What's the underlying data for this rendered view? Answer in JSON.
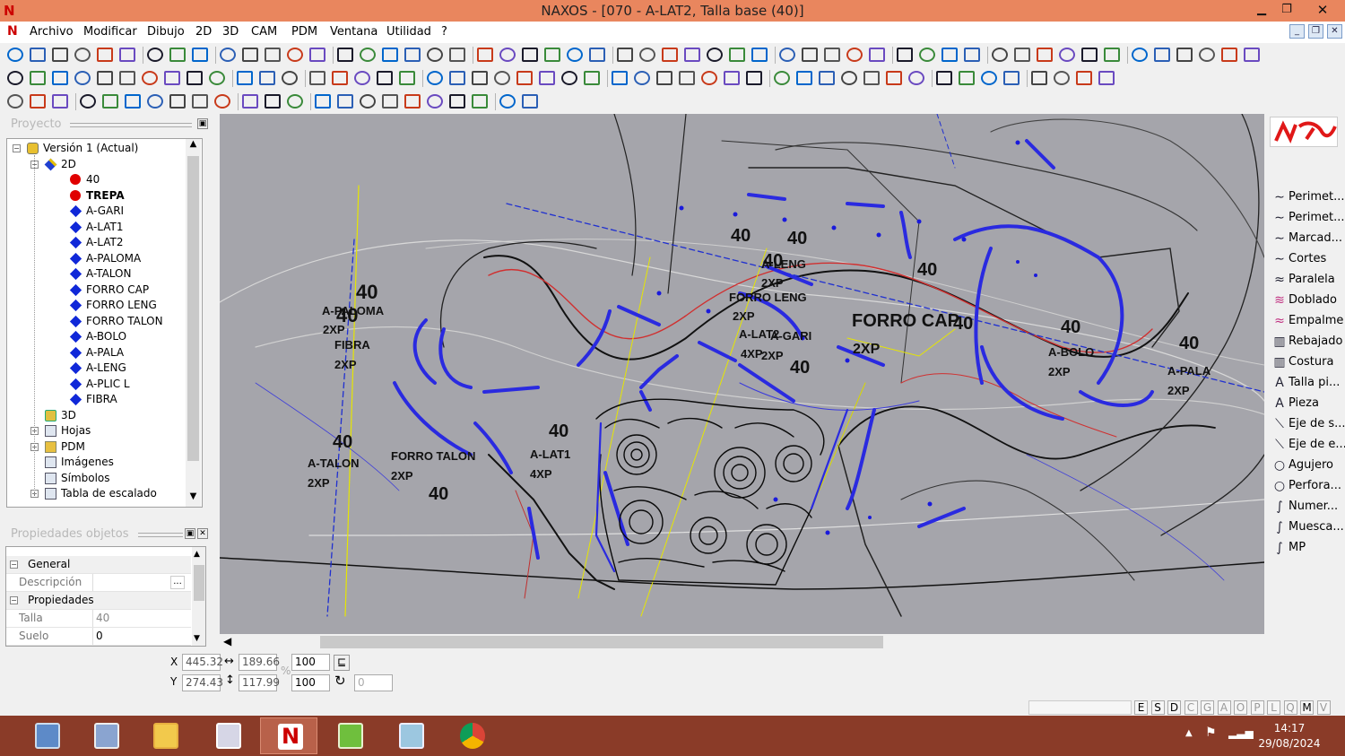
{
  "window": {
    "title": "NAXOS - [070 - A-LAT2, Talla base (40)]",
    "logo": "N",
    "colors": {
      "titlebar": "#e9865e",
      "canvas": "#a5a5ab",
      "taskbar": "#8a3b28"
    }
  },
  "window_controls": {
    "minimize": "▁",
    "restore": "❐",
    "close": "✕"
  },
  "menu": [
    "Archivo",
    "Modificar",
    "Dibujo",
    "2D",
    "3D",
    "CAM",
    "PDM",
    "Ventana",
    "Utilidad",
    "?"
  ],
  "mdi_controls": {
    "minimize": "_",
    "restore": "❐",
    "close": "✕"
  },
  "project_panel": {
    "title": "Proyecto",
    "pin": "▣"
  },
  "tree": {
    "items": [
      "Versión 1 (Actual)",
      "2D",
      "40",
      "TREPA",
      "A-GARI",
      "A-LAT1",
      "A-LAT2",
      "A-PALOMA",
      "A-TALON",
      "FORRO CAP",
      "FORRO LENG",
      "FORRO TALON",
      "A-BOLO",
      "A-PALA",
      "A-LENG",
      "A-PLIC L",
      "FIBRA",
      "3D",
      "Hojas",
      "PDM",
      "Imágenes",
      "Símbolos",
      "Tabla de escalado"
    ]
  },
  "properties_panel": {
    "title": "Propiedades objetos",
    "pin": "▣",
    "close": "✕",
    "categories": [
      "General",
      "Propiedades"
    ],
    "rows": [
      {
        "label": "Descripción",
        "value": "",
        "button": "..."
      },
      {
        "label": "Talla",
        "value": "40"
      },
      {
        "label": "Suelo",
        "value": "0"
      }
    ]
  },
  "canvas_labels": [
    {
      "text": "40"
    },
    {
      "text": "A-PALOMA"
    },
    {
      "text": "2XP"
    },
    {
      "text": "40"
    },
    {
      "text": "FIBRA"
    },
    {
      "text": "2XP"
    },
    {
      "text": "40"
    },
    {
      "text": "A-TALON"
    },
    {
      "text": "2XP"
    },
    {
      "text": "FORRO TALON"
    },
    {
      "text": "2XP"
    },
    {
      "text": "40"
    },
    {
      "text": "40"
    },
    {
      "text": "A-LAT1"
    },
    {
      "text": "4XP"
    },
    {
      "text": "40"
    },
    {
      "text": "40"
    },
    {
      "text": "40"
    },
    {
      "text": "A-LENG"
    },
    {
      "text": "2XP"
    },
    {
      "text": "FORRO LENG"
    },
    {
      "text": "2XP"
    },
    {
      "text": "A-LAT2"
    },
    {
      "text": "A-GARI"
    },
    {
      "text": "4XP"
    },
    {
      "text": "2XP"
    },
    {
      "text": "40"
    },
    {
      "text": "FORRO CAP"
    },
    {
      "text": "2XP"
    },
    {
      "text": "40"
    },
    {
      "text": "40"
    },
    {
      "text": "40"
    },
    {
      "text": "A-BOLO"
    },
    {
      "text": "2XP"
    },
    {
      "text": "40"
    },
    {
      "text": "A-PALA"
    },
    {
      "text": "2XP"
    }
  ],
  "right_panel": {
    "items": [
      {
        "label": "Perimet...",
        "icon": "curve-icon"
      },
      {
        "label": "Perimet...",
        "icon": "curve-icon"
      },
      {
        "label": "Marcad...",
        "icon": "curve-icon"
      },
      {
        "label": "Cortes",
        "icon": "curve-icon"
      },
      {
        "label": "Paralela",
        "icon": "parallel-icon"
      },
      {
        "label": "Doblado",
        "icon": "fold-icon"
      },
      {
        "label": "Empalme",
        "icon": "join-icon"
      },
      {
        "label": "Rebajado",
        "icon": "skive-icon"
      },
      {
        "label": "Costura",
        "icon": "seam-icon"
      },
      {
        "label": "Talla pi...",
        "icon": "text-a-icon"
      },
      {
        "label": "Pieza",
        "icon": "text-a-icon"
      },
      {
        "label": "Eje de s...",
        "icon": "axis-icon"
      },
      {
        "label": "Eje de e...",
        "icon": "axis-icon"
      },
      {
        "label": "Agujero",
        "icon": "circle-icon"
      },
      {
        "label": "Perfora...",
        "icon": "circle-icon"
      },
      {
        "label": "Numer...",
        "icon": "pen-icon"
      },
      {
        "label": "Muesca...",
        "icon": "pen-icon"
      },
      {
        "label": "MP",
        "icon": "pen-icon"
      }
    ]
  },
  "coords": {
    "x_label": "X",
    "y_label": "Y",
    "x": "445.32",
    "y": "274.43",
    "width": "189.66",
    "height": "117.99",
    "scale_x": "100",
    "scale_y": "100",
    "rotation": "0",
    "percent": "%"
  },
  "status_letters": [
    "E",
    "S",
    "D",
    "C",
    "G",
    "A",
    "O",
    "P",
    "L",
    "Q",
    "M",
    "V"
  ],
  "clock": {
    "time": "14:17",
    "date": "29/08/2024"
  }
}
